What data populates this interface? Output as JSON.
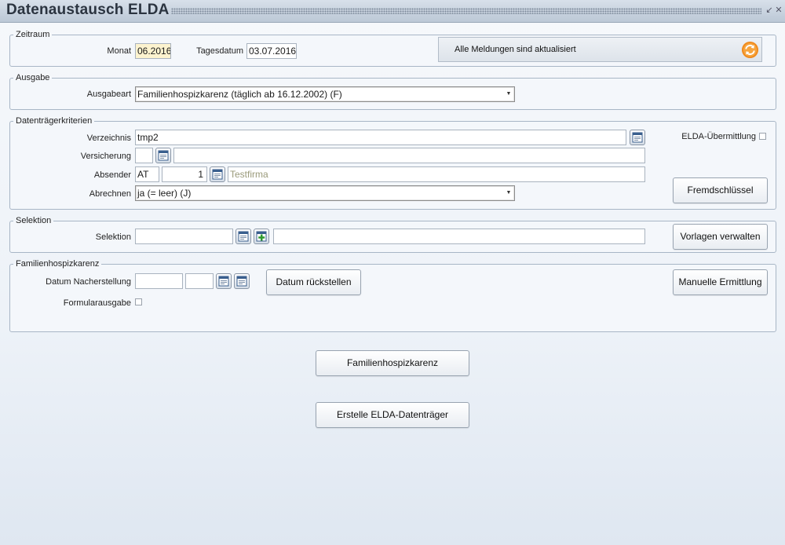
{
  "window": {
    "title": "Datenaustausch ELDA"
  },
  "zeitraum": {
    "legend": "Zeitraum",
    "monat_label": "Monat",
    "monat_value": "06.2016",
    "tagesdatum_label": "Tagesdatum",
    "tagesdatum_value": "03.07.2016",
    "status_text": "Alle Meldungen sind aktualisiert"
  },
  "ausgabe": {
    "legend": "Ausgabe",
    "ausgabeart_label": "Ausgabeart",
    "ausgabeart_value": "Familienhospizkarenz (täglich ab 16.12.2002) (F)"
  },
  "datentraeger": {
    "legend": "Datenträgerkriterien",
    "verzeichnis_label": "Verzeichnis",
    "verzeichnis_value": "tmp2",
    "versicherung_label": "Versicherung",
    "versicherung_code": "",
    "versicherung_name": "",
    "absender_label": "Absender",
    "absender_country": "AT",
    "absender_number": "1",
    "absender_name": "Testfirma",
    "abrechnen_label": "Abrechnen",
    "abrechnen_value": "ja (= leer) (J)",
    "elda_label": "ELDA-Übermittlung",
    "elda_checked": false,
    "fremdschluessel_label": "Fremdschlüssel"
  },
  "selektion": {
    "legend": "Selektion",
    "selektion_label": "Selektion",
    "selektion_value": "",
    "selektion_desc": "",
    "vorlagen_label": "Vorlagen verwalten"
  },
  "familienhospiz": {
    "legend": "Familienhospizkarenz",
    "datum_label": "Datum Nacherstellung",
    "datum_value1": "",
    "datum_value2": "",
    "datum_button_label": "Datum rückstellen",
    "formular_label": "Formularausgabe",
    "formular_checked": false,
    "manuelle_label": "Manuelle Ermittlung"
  },
  "actions": {
    "familienhospizkarenz_label": "Familienhospizkarenz",
    "erstelle_label": "Erstelle ELDA-Datenträger"
  },
  "icons": {
    "calendar": "calendar-icon",
    "add": "add-icon",
    "refresh": "refresh-icon",
    "dropdown": "dropdown-arrow-icon"
  },
  "colors": {
    "highlight_field": "#fcf3cf",
    "refresh_orange": "#f08a1c",
    "add_green": "#2f9a2f",
    "group_border": "#a8b6c6"
  }
}
